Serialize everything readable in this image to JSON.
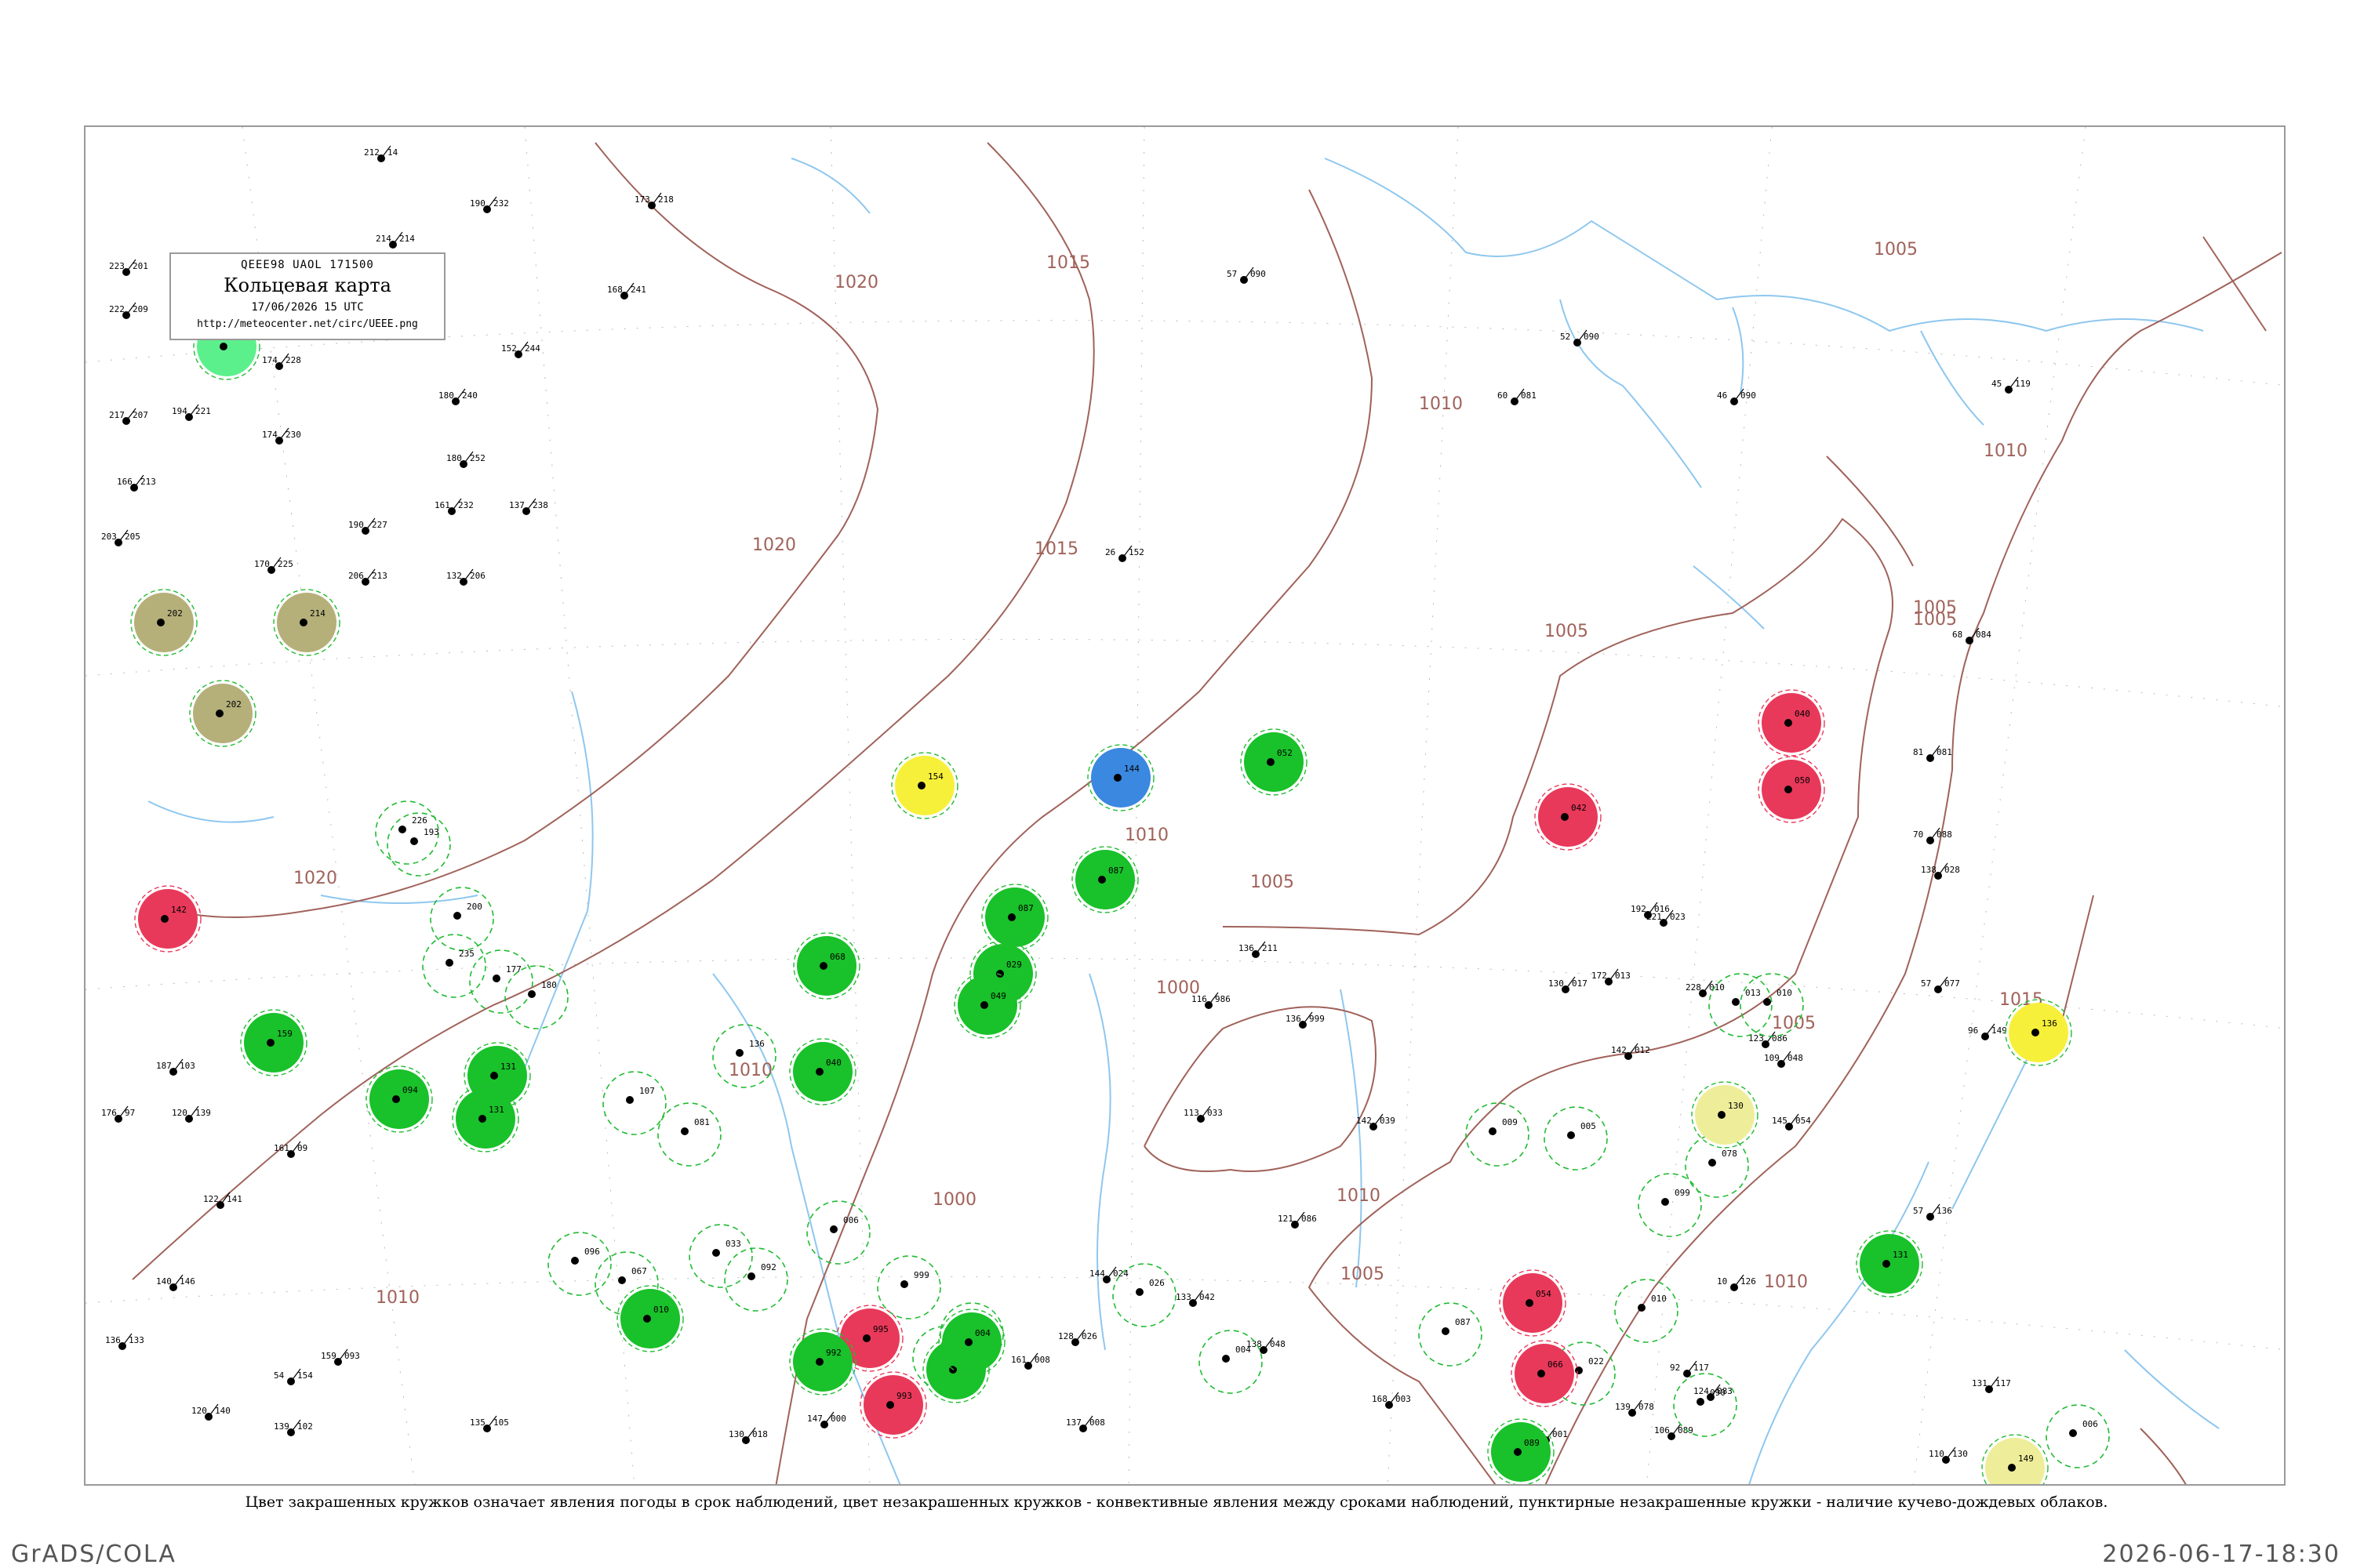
{
  "header": {
    "code": "QEEE98  UAOL  171500",
    "title": "Кольцевая карта",
    "date": "17/06/2026 15 UTC",
    "url": "http://meteocenter.net/circ/UEEE.png"
  },
  "caption": "Цвет закрашенных кружков означает явления погоды в срок наблюдений, цвет незакрашенных кружков - конвективные явления между сроками наблюдений, пунктирные незакрашенные кружки - наличие кучево-дождевых облаков.",
  "footer": {
    "left": "GrADS/COLA",
    "right": "2026-06-17-18:30"
  },
  "colors": {
    "isobar": "#a0625a",
    "river": "#8ec7ef",
    "thunder": "#e8395a",
    "rain": "#19c12a",
    "showers": "#3a88e0",
    "fog": "#b5b07a",
    "haze": "#f7f03a",
    "mist": "#eeee9a",
    "drizzle": "#5cf08c",
    "cb_dashed": "#22bb33",
    "convective_ring": "#e8395a"
  },
  "isobar_labels": [
    "1020",
    "1015",
    "1005",
    "1020",
    "1015",
    "1010",
    "1010",
    "1005",
    "1005",
    "1005",
    "1010",
    "1020",
    "1010",
    "1000",
    "1000",
    "1010",
    "1005",
    "1015",
    "1010",
    "1005",
    "1005",
    "1010",
    "1005"
  ],
  "stations": [
    {
      "value": "212",
      "value2": "14"
    },
    {
      "value": "190",
      "value2": "232"
    },
    {
      "value": "214",
      "value2": "214"
    },
    {
      "value": "223",
      "value2": "201"
    },
    {
      "value": "222",
      "value2": "209"
    },
    {
      "value": "174",
      "value2": "228"
    },
    {
      "value": "195",
      "value2": "234"
    },
    {
      "value": "168",
      "value2": "241"
    },
    {
      "value": "173",
      "value2": "218"
    },
    {
      "value": "152",
      "value2": "244"
    },
    {
      "value": "180",
      "value2": "240"
    },
    {
      "value": "217",
      "value2": "207"
    },
    {
      "value": "194",
      "value2": "221"
    },
    {
      "value": "174",
      "value2": "230"
    },
    {
      "value": "180",
      "value2": "252"
    },
    {
      "value": "166",
      "value2": "213"
    },
    {
      "value": "161",
      "value2": "232"
    },
    {
      "value": "137",
      "value2": "238"
    },
    {
      "value": "190",
      "value2": "227"
    },
    {
      "value": "206",
      "value2": "213"
    },
    {
      "value": "203",
      "value2": "205"
    },
    {
      "value": "170",
      "value2": "225"
    },
    {
      "value": "132",
      "value2": "206"
    },
    {
      "value": "52",
      "value2": "090"
    },
    {
      "value": "26",
      "value2": "152"
    },
    {
      "value": "57",
      "value2": "090"
    },
    {
      "value": "60",
      "value2": "081"
    },
    {
      "value": "46",
      "value2": "090"
    },
    {
      "value": "45",
      "value2": "119"
    },
    {
      "value": "68",
      "value2": "084"
    },
    {
      "value": "81",
      "value2": "081"
    },
    {
      "value": "70",
      "value2": "088"
    },
    {
      "value": "138",
      "value2": "028"
    },
    {
      "value": "192",
      "value2": "016"
    },
    {
      "value": "221",
      "value2": "023"
    },
    {
      "value": "130",
      "value2": "017"
    },
    {
      "value": "172",
      "value2": "013"
    },
    {
      "value": "228",
      "value2": "010"
    },
    {
      "value": "142",
      "value2": "012"
    },
    {
      "value": "109",
      "value2": "048"
    },
    {
      "value": "123",
      "value2": "086"
    },
    {
      "value": "57",
      "value2": "077"
    },
    {
      "value": "145",
      "value2": "054"
    },
    {
      "value": "57",
      "value2": "136"
    },
    {
      "value": "10",
      "value2": "126"
    },
    {
      "value": "92",
      "value2": "117"
    },
    {
      "value": "124",
      "value2": "083"
    },
    {
      "value": "131",
      "value2": "117"
    },
    {
      "value": "110",
      "value2": "130"
    },
    {
      "value": "96",
      "value2": "149"
    },
    {
      "value": "139",
      "value2": "078"
    },
    {
      "value": "106",
      "value2": "089"
    },
    {
      "value": "168",
      "value2": "003"
    },
    {
      "value": "165",
      "value2": "001"
    },
    {
      "value": "116",
      "value2": "986"
    },
    {
      "value": "136",
      "value2": "211"
    },
    {
      "value": "136",
      "value2": "999"
    },
    {
      "value": "113",
      "value2": "033"
    },
    {
      "value": "142",
      "value2": "039"
    },
    {
      "value": "121",
      "value2": "086"
    },
    {
      "value": "144",
      "value2": "024"
    },
    {
      "value": "133",
      "value2": "042"
    },
    {
      "value": "138",
      "value2": "048"
    },
    {
      "value": "128",
      "value2": "026"
    },
    {
      "value": "137",
      "value2": "008"
    },
    {
      "value": "161",
      "value2": "008"
    },
    {
      "value": "147",
      "value2": "000"
    },
    {
      "value": "130",
      "value2": "018"
    },
    {
      "value": "135",
      "value2": "105"
    },
    {
      "value": "120",
      "value2": "140"
    },
    {
      "value": "54",
      "value2": "154"
    },
    {
      "value": "140",
      "value2": "146"
    },
    {
      "value": "136",
      "value2": "133"
    },
    {
      "value": "139",
      "value2": "102"
    },
    {
      "value": "161",
      "value2": "09"
    },
    {
      "value": "122",
      "value2": "141"
    },
    {
      "value": "159",
      "value2": "093"
    },
    {
      "value": "187",
      "value2": "103"
    },
    {
      "value": "120",
      "value2": "139"
    },
    {
      "value": "176",
      "value2": "97"
    }
  ],
  "circles": [
    {
      "kind": "drizzle",
      "value": "34"
    },
    {
      "kind": "fog",
      "value": "202"
    },
    {
      "kind": "fog",
      "value": "214"
    },
    {
      "kind": "fog",
      "value": "202"
    },
    {
      "kind": "thunder",
      "value": "142"
    },
    {
      "kind": "rain",
      "value": "159"
    },
    {
      "kind": "rain",
      "value": "131"
    },
    {
      "kind": "rain",
      "value": "131"
    },
    {
      "kind": "haze",
      "value": "154"
    },
    {
      "kind": "showers",
      "value": "144"
    },
    {
      "kind": "rain",
      "value": "052"
    },
    {
      "kind": "rain",
      "value": "087"
    },
    {
      "kind": "rain",
      "value": "087"
    },
    {
      "kind": "rain",
      "value": "029"
    },
    {
      "kind": "rain",
      "value": "049"
    },
    {
      "kind": "rain",
      "value": "068"
    },
    {
      "kind": "rain",
      "value": "040"
    },
    {
      "kind": "thunder",
      "value": "042"
    },
    {
      "kind": "thunder",
      "value": "040"
    },
    {
      "kind": "thunder",
      "value": "050"
    },
    {
      "kind": "thunder",
      "value": "054"
    },
    {
      "kind": "thunder",
      "value": "995"
    },
    {
      "kind": "thunder",
      "value": "993"
    },
    {
      "kind": "rain",
      "value": "992"
    },
    {
      "kind": "rain",
      "value": "000"
    },
    {
      "kind": "rain",
      "value": "004"
    },
    {
      "kind": "rain",
      "value": "010"
    },
    {
      "kind": "rain",
      "value": "089"
    },
    {
      "kind": "rain",
      "value": "131"
    },
    {
      "kind": "haze",
      "value": "136"
    },
    {
      "kind": "mist",
      "value": "149"
    },
    {
      "kind": "mist",
      "value": "130"
    },
    {
      "kind": "thunder",
      "value": "066"
    },
    {
      "kind": "rain",
      "value": "094"
    }
  ],
  "dashed_rings": [
    "226",
    "193",
    "200",
    "235",
    "177",
    "180",
    "136",
    "107",
    "081",
    "096",
    "067",
    "033",
    "092",
    "006",
    "999",
    "070",
    "012",
    "026",
    "004",
    "009",
    "005",
    "087",
    "022",
    "010",
    "090",
    "013",
    "010",
    "078",
    "099",
    "006"
  ]
}
